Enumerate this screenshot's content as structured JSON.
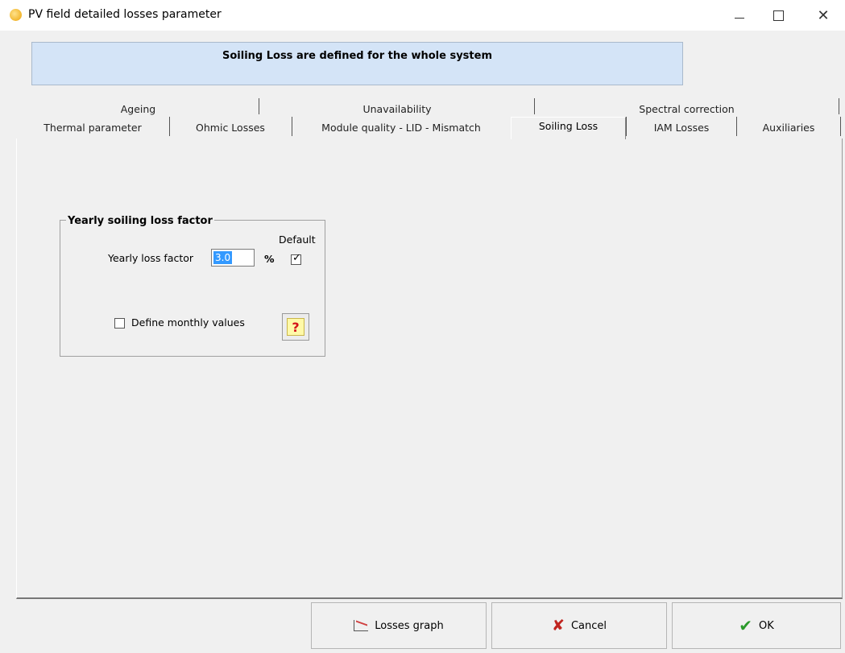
{
  "window": {
    "title": "PV field detailed losses parameter",
    "minimize": "—",
    "maximize": "",
    "close": "✕"
  },
  "banner": {
    "text": "Soiling Loss  are defined for the whole system"
  },
  "tabs": {
    "row1": [
      "Ageing",
      "Unavailability",
      "Spectral correction"
    ],
    "row2": [
      "Thermal parameter",
      "Ohmic Losses",
      "Module quality - LID - Mismatch",
      "Soiling Loss",
      "IAM Losses",
      "Auxiliaries"
    ],
    "active": "Soiling Loss"
  },
  "soiling": {
    "group_title": "Yearly soiling loss factor",
    "default_label": "Default",
    "yearly_label": "Yearly loss factor",
    "yearly_value": "3.0",
    "unit": "%",
    "default_checked": true,
    "monthly_label": "Define monthly values",
    "monthly_checked": false,
    "help": "?"
  },
  "buttons": {
    "graph": "Losses graph",
    "cancel": "Cancel",
    "ok": "OK"
  },
  "colors": {
    "banner_bg": "#d4e4f7",
    "selection": "#3399ff",
    "cancel": "#c0241f",
    "ok": "#2a9a2a"
  }
}
